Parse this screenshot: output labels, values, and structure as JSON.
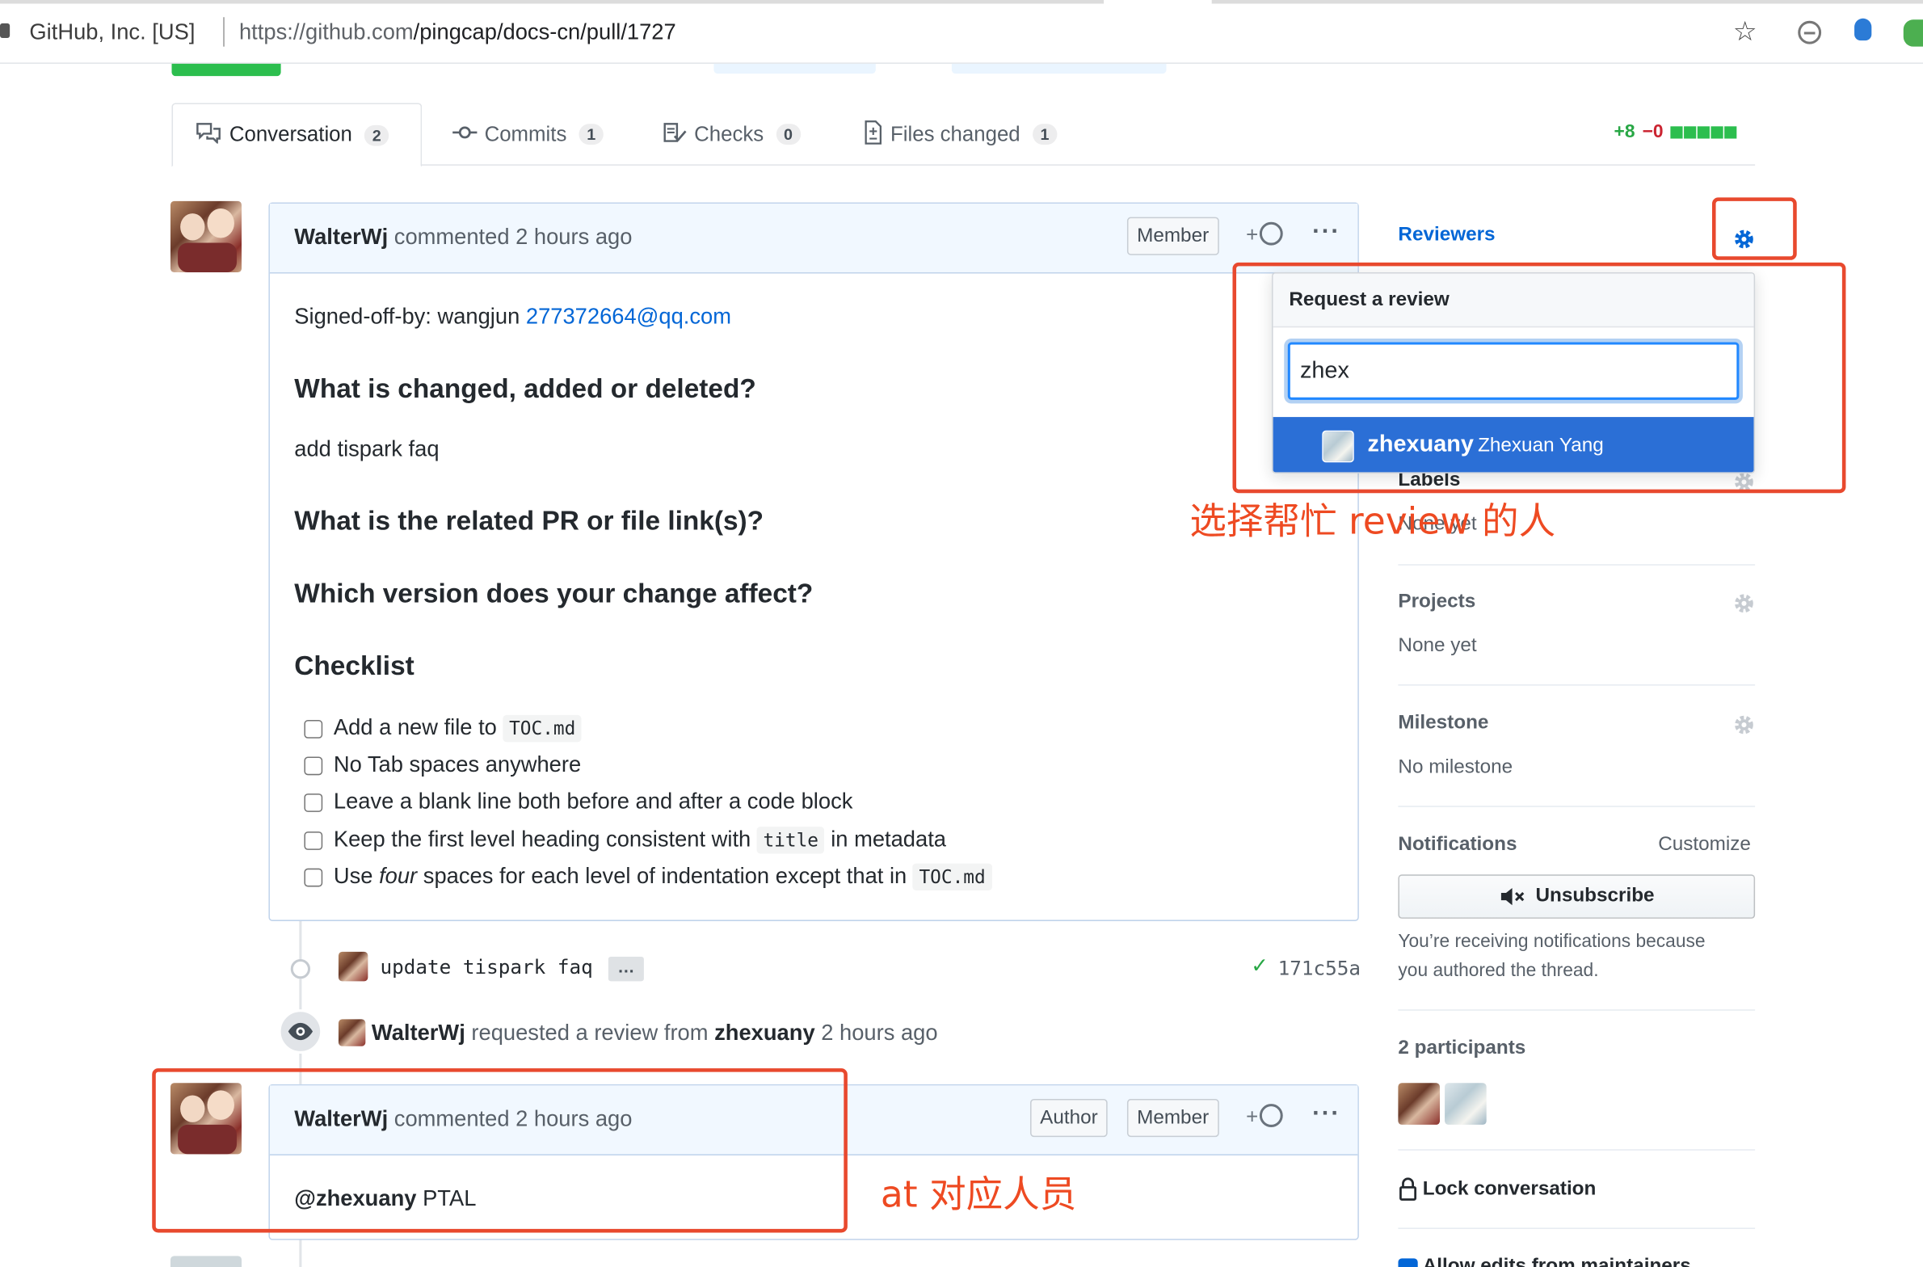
{
  "browser": {
    "org_label": "GitHub, Inc. [US]",
    "url_host": "https://github.com",
    "url_path": "/pingcap/docs-cn/pull/1727"
  },
  "tabs": [
    {
      "label": "Conversation",
      "count": "2",
      "icon": "comment-discussion-icon"
    },
    {
      "label": "Commits",
      "count": "1",
      "icon": "git-commit-icon"
    },
    {
      "label": "Checks",
      "count": "0",
      "icon": "checklist-icon"
    },
    {
      "label": "Files changed",
      "count": "1",
      "icon": "file-diff-icon"
    }
  ],
  "diffstat": {
    "additions": "+8",
    "deletions": "−0"
  },
  "comment1": {
    "author": "WalterWj",
    "action": "commented 2 hours ago",
    "badge": "Member",
    "react": "+",
    "signed_off_prefix": "Signed-off-by: wangjun",
    "signed_off_email": "277372664@qq.com",
    "h_changed": "What is changed, added or deleted?",
    "p_changed": "add tispark faq",
    "h_related": "What is the related PR or file link(s)?",
    "h_version": "Which version does your change affect?",
    "h_checklist": "Checklist",
    "checklist": {
      "i1_pre": "Add a new file to",
      "i1_code": "TOC.md",
      "i2": "No Tab spaces anywhere",
      "i3": "Leave a blank line both before and after a code block",
      "i4_pre": "Keep the first level heading consistent with",
      "i4_code": "title",
      "i4_post": "in metadata",
      "i5_pre": "Use",
      "i5_em": "four",
      "i5_mid": "spaces for each level of indentation except that in",
      "i5_code": "TOC.md"
    }
  },
  "commit_event": {
    "message": "update tispark faq",
    "ellipsis": "…",
    "sha": "171c55a"
  },
  "review_event": {
    "actor": "WalterWj",
    "text": "requested a review from",
    "target": "zhexuany",
    "time": "2 hours ago"
  },
  "comment2": {
    "author": "WalterWj",
    "action": "commented 2 hours ago",
    "badge_author": "Author",
    "badge_member": "Member",
    "react": "+",
    "mention": "@zhexuany",
    "body": "PTAL"
  },
  "sidebar": {
    "reviewers_title": "Reviewers",
    "labels_title": "Labels",
    "labels_value": "None yet",
    "projects_title": "Projects",
    "projects_value": "None yet",
    "milestone_title": "Milestone",
    "milestone_value": "No milestone",
    "notifications_title": "Notifications",
    "customize": "Customize",
    "unsubscribe": "Unsubscribe",
    "notif_reason_1": "You’re receiving notifications because",
    "notif_reason_2": "you authored the thread.",
    "participants": "2 participants",
    "lock": "Lock conversation",
    "allow_edits": "Allow edits from maintainers"
  },
  "review_popover": {
    "title": "Request a review",
    "input_value": "zhex",
    "option_login": "zhexuany",
    "option_name": "Zhexuan Yang"
  },
  "annotations": {
    "select_reviewer": "选择帮忙 review 的人",
    "at_person": "at 对应人员",
    "color": "#ee4a22"
  },
  "colors": {
    "link": "#0366d6",
    "green": "#2cbe4e",
    "red": "#cb2431",
    "highlight": "#2b6fd6"
  }
}
